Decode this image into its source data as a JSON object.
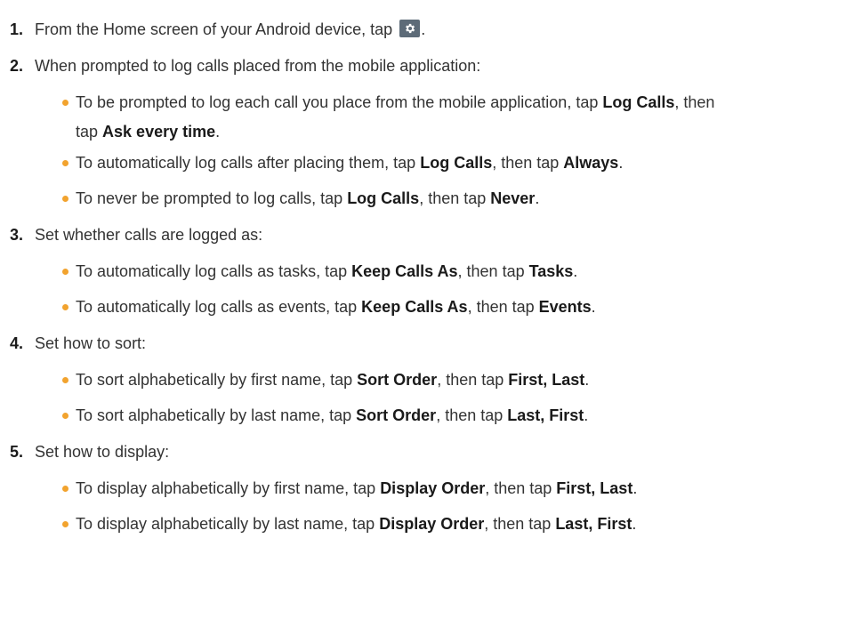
{
  "icons": {
    "settings": "gear-icon",
    "bullet": "bullet-dot",
    "bullet_color": "#f2a32e",
    "icon_bg": "#5d6b78"
  },
  "steps": [
    {
      "num": "1.",
      "before_icon": "From the Home screen of your Android device, tap",
      "after_icon": "."
    },
    {
      "num": "2.",
      "text": "When prompted to log calls placed from the mobile application:",
      "bullets": [
        {
          "t1": "To be prompted to log each call you place from the mobile application, tap ",
          "b1": "Log Calls",
          "t2": ", then",
          "t3": "tap ",
          "b2": "Ask every time",
          "t4": "."
        },
        {
          "t1": "To automatically log calls after placing them, tap ",
          "b1": "Log Calls",
          "t2": ", then tap ",
          "b2": "Always",
          "t3": "."
        },
        {
          "t1": "To never be prompted to log calls, tap ",
          "b1": "Log Calls",
          "t2": ", then tap ",
          "b2": "Never",
          "t3": "."
        }
      ]
    },
    {
      "num": "3.",
      "text": "Set whether calls are logged as:",
      "bullets": [
        {
          "t1": "To automatically log calls as tasks, tap ",
          "b1": "Keep Calls As",
          "t2": ", then tap ",
          "b2": "Tasks",
          "t3": "."
        },
        {
          "t1": "To automatically log calls as events, tap ",
          "b1": "Keep Calls As",
          "t2": ", then tap ",
          "b2": "Events",
          "t3": "."
        }
      ]
    },
    {
      "num": "4.",
      "text": "Set how to sort:",
      "bullets": [
        {
          "t1": "To sort alphabetically by first name, tap ",
          "b1": "Sort Order",
          "t2": ", then tap ",
          "b2": "First, Last",
          "t3": "."
        },
        {
          "t1": "To sort alphabetically by last name, tap ",
          "b1": "Sort Order",
          "t2": ", then tap ",
          "b2": "Last, First",
          "t3": "."
        }
      ]
    },
    {
      "num": "5.",
      "text": "Set how to display:",
      "bullets": [
        {
          "t1": "To display alphabetically by first name, tap ",
          "b1": "Display Order",
          "t2": ", then tap ",
          "b2": "First, Last",
          "t3": "."
        },
        {
          "t1": "To display alphabetically by last name, tap ",
          "b1": "Display Order",
          "t2": ", then tap ",
          "b2": "Last, First",
          "t3": "."
        }
      ]
    }
  ]
}
